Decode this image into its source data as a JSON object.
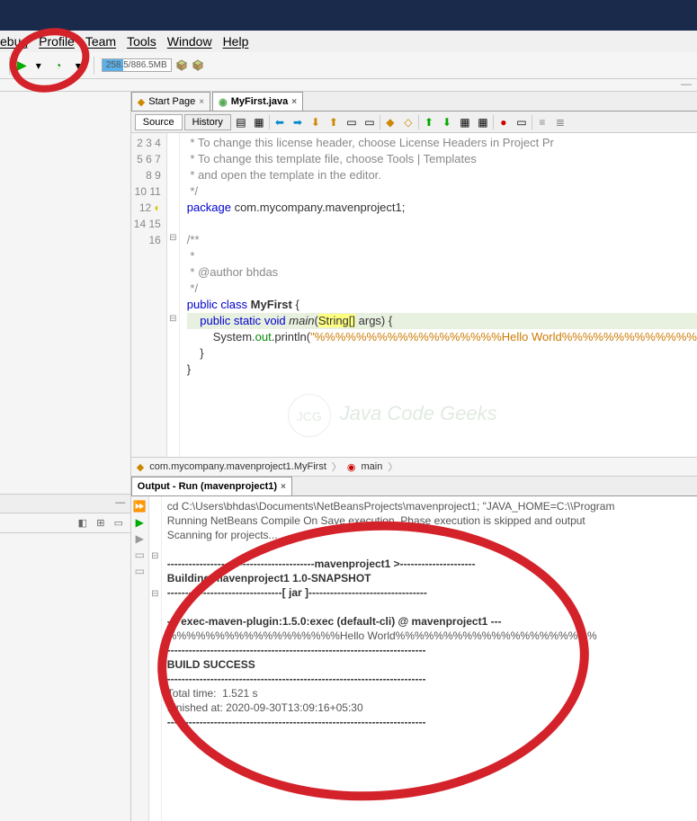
{
  "menu": {
    "debug": "ebug",
    "profile": "Profile",
    "team": "Team",
    "tools": "Tools",
    "window": "Window",
    "help": "Help"
  },
  "memory": "258.5/886.5MB",
  "tabs": {
    "start": "Start Page",
    "file": "MyFirst.java"
  },
  "srcTabs": {
    "source": "Source",
    "history": "History"
  },
  "code": {
    "l2": " * To change this license header, choose License Headers in Project Pr",
    "l3": " * To change this template file, choose Tools | Templates",
    "l4": " * and open the template in the editor.",
    "l5": " */",
    "l7_pkg": "package",
    "l7_rest": " com.mycompany.mavenproject1;",
    "l8": "/**",
    "l9": " *",
    "l10": " * @author bhdas",
    "l11": " */",
    "l12_pub": "public",
    "l12_cls": "class",
    "l12_name": "MyFirst",
    "l12_brace": " {",
    "l13_pub": "public",
    "l13_static": "static",
    "l13_void": "void",
    "l13_main": "main",
    "l13_str": "String",
    "l13_args": " args) {",
    "l14_sys": "        System.",
    "l14_out": "out",
    "l14_pr": ".println(",
    "l14_str": "\"%%%%%%%%%%%%%%%%%%Hello World%%%%%%%%%%%%%",
    "l15": "    }",
    "l16": "}"
  },
  "breadcrumb": {
    "pkg": "com.mycompany.mavenproject1.MyFirst",
    "method": "main"
  },
  "outputTab": "Output - Run (mavenproject1)",
  "output": {
    "l1": "cd C:\\Users\\bhdas\\Documents\\NetBeansProjects\\mavenproject1; \"JAVA_HOME=C:\\\\Program",
    "l2": "Running NetBeans Compile On Save execution. Phase execution is skipped and output ",
    "l3": "Scanning for projects...",
    "l4": "",
    "l5": "-----------------------------------------mavenproject1 >---------------------",
    "l6": "Building mavenproject1 1.0-SNAPSHOT",
    "l7": "--------------------------------[ jar ]---------------------------------",
    "l8": "",
    "l9": "--- exec-maven-plugin:1.5.0:exec (default-cli) @ mavenproject1 ---",
    "l10": "%%%%%%%%%%%%%%%%%%Hello World%%%%%%%%%%%%%%%%%%%%%",
    "l11": "------------------------------------------------------------------------",
    "l12": "BUILD SUCCESS",
    "l13": "------------------------------------------------------------------------",
    "l14": "Total time:  1.521 s",
    "l15": "Finished at: 2020-09-30T13:09:16+05:30",
    "l16": "------------------------------------------------------------------------"
  },
  "watermark": "Java Code Geeks"
}
